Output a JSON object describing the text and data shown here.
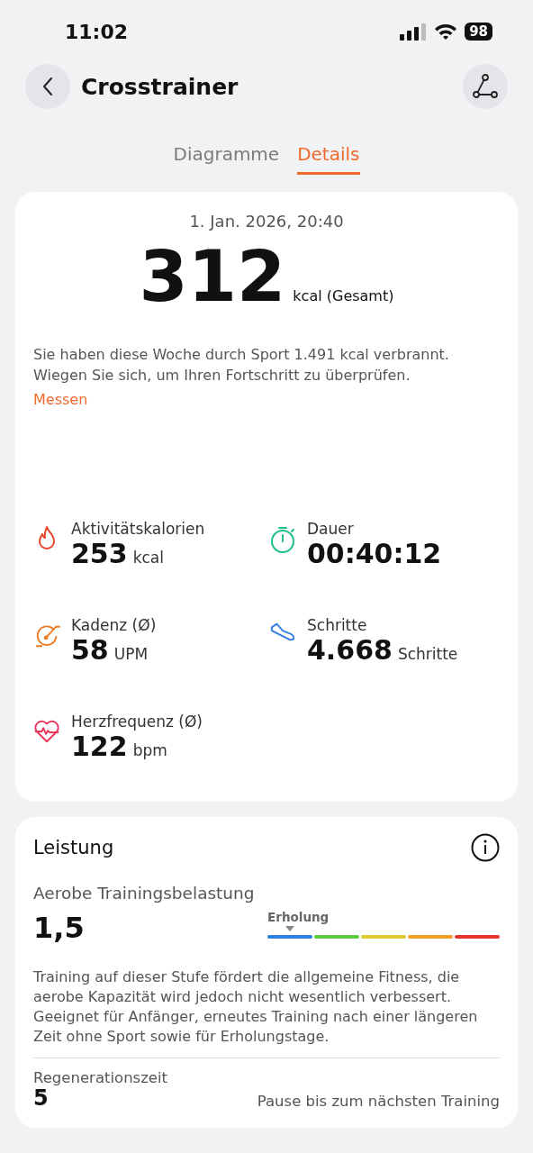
{
  "status_bar": {
    "time": "11:02",
    "battery": "98"
  },
  "header": {
    "title": "Crosstrainer"
  },
  "tabs": [
    {
      "label": "Diagramme",
      "selected": false
    },
    {
      "label": "Details",
      "selected": true
    }
  ],
  "summary": {
    "date": "1. Jan. 2026, 20:40",
    "value": "312",
    "unit": "kcal (Gesamt)",
    "message": "Sie haben diese Woche durch Sport 1.491 kcal verbrannt. Wiegen Sie sich, um Ihren Fortschritt zu überprüfen.",
    "link": "Messen"
  },
  "metrics": [
    {
      "kind": "flame",
      "label": "Aktivitätskalorien",
      "value": "253",
      "unit": "kcal",
      "color": "#e8452c"
    },
    {
      "kind": "timer",
      "label": "Dauer",
      "value": "00:40:12",
      "color": "#1fbf8a"
    },
    {
      "kind": "cadence",
      "label": "Kadenz (Ø)",
      "value": "58",
      "unit": "UPM",
      "color": "#ee7a22"
    },
    {
      "kind": "shoe",
      "label": "Schritte",
      "value": "4.668",
      "unit": "Schritte",
      "color": "#2f7fe0"
    },
    {
      "kind": "heart",
      "label": "Herzfrequenz (Ø)",
      "value": "122",
      "unit": "bpm",
      "color": "#e8345a"
    }
  ],
  "performance": {
    "title": "Leistung",
    "load": {
      "label": "Aerobe Trainingsbelastung",
      "value": "1,5",
      "scale_label": "Erholung",
      "segments": [
        {
          "color": "#2f7fe0",
          "selected": true
        },
        {
          "color": "#5cc93a",
          "selected": false
        },
        {
          "color": "#e2cc2c",
          "selected": false
        },
        {
          "color": "#eea02c",
          "selected": false
        },
        {
          "color": "#e8322c",
          "selected": false
        }
      ],
      "description": "Training auf dieser Stufe fördert die allgemeine Fitness, die aerobe Kapazität wird jedoch nicht wesentlich verbessert. Geeignet für Anfänger, erneutes Training nach einer längeren Zeit ohne Sport sowie für Erholungstage."
    },
    "recovery": {
      "label": "Regenerationszeit",
      "value": "5",
      "note": "Pause bis zum nächsten Training"
    }
  }
}
